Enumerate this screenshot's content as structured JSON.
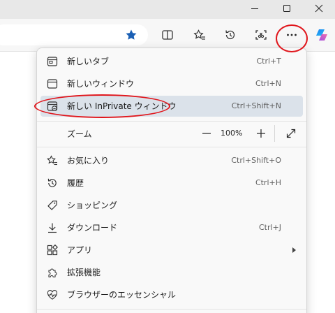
{
  "window": {
    "minimize_glyph": "—",
    "maximize_glyph": "□",
    "close_glyph": "✕"
  },
  "toolbar": {
    "favorite_icon": "star-filled-icon",
    "more_label": "···"
  },
  "menu": {
    "items": [
      {
        "label": "新しいタブ",
        "shortcut": "Ctrl+T",
        "icon": "new-tab-icon"
      },
      {
        "label": "新しいウィンドウ",
        "shortcut": "Ctrl+N",
        "icon": "new-window-icon"
      },
      {
        "label": "新しい InPrivate ウィンドウ",
        "shortcut": "Ctrl+Shift+N",
        "icon": "inprivate-window-icon"
      }
    ],
    "zoom": {
      "label": "ズーム",
      "minus": "—",
      "value": "100%",
      "plus": "+"
    },
    "items2": [
      {
        "label": "お気に入り",
        "shortcut": "Ctrl+Shift+O",
        "icon": "favorites-icon"
      },
      {
        "label": "履歴",
        "shortcut": "Ctrl+H",
        "icon": "history-icon"
      },
      {
        "label": "ショッピング",
        "shortcut": "",
        "icon": "shopping-tag-icon"
      },
      {
        "label": "ダウンロード",
        "shortcut": "Ctrl+J",
        "icon": "download-icon"
      },
      {
        "label": "アプリ",
        "shortcut": "",
        "icon": "apps-icon"
      },
      {
        "label": "拡張機能",
        "shortcut": "",
        "icon": "extensions-icon"
      },
      {
        "label": "ブラウザーのエッセンシャル",
        "shortcut": "",
        "icon": "browser-essentials-icon"
      }
    ]
  },
  "colors": {
    "accent": "#1a5fb4",
    "highlight_row": "#dbe2ea",
    "annotation_ring": "#e0161c"
  }
}
